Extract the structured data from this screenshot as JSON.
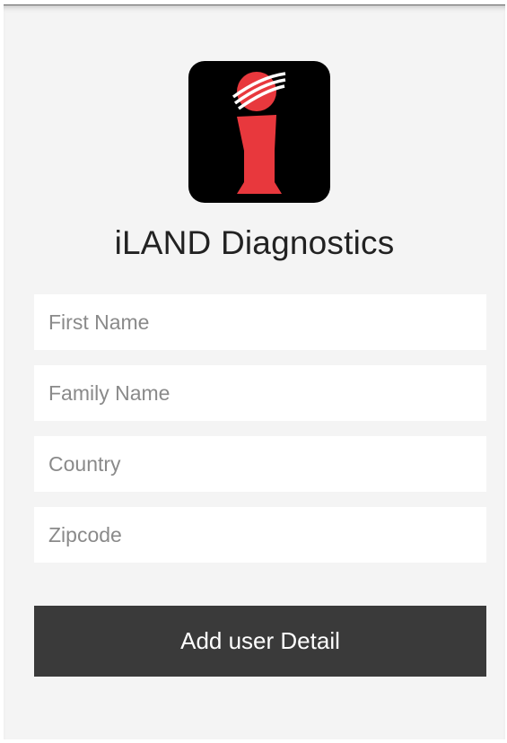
{
  "app": {
    "title": "iLAND Diagnostics",
    "logo_icon": "iland-logo-icon"
  },
  "form": {
    "first_name": {
      "placeholder": "First Name",
      "value": ""
    },
    "family_name": {
      "placeholder": "Family Name",
      "value": ""
    },
    "country": {
      "placeholder": "Country",
      "value": ""
    },
    "zipcode": {
      "placeholder": "Zipcode",
      "value": ""
    },
    "submit_label": "Add user Detail"
  },
  "colors": {
    "background": "#f4f4f4",
    "field_background": "#ffffff",
    "button_background": "#3a3a3a",
    "button_text": "#ffffff",
    "logo_background": "#000000",
    "logo_red": "#e8383d"
  }
}
